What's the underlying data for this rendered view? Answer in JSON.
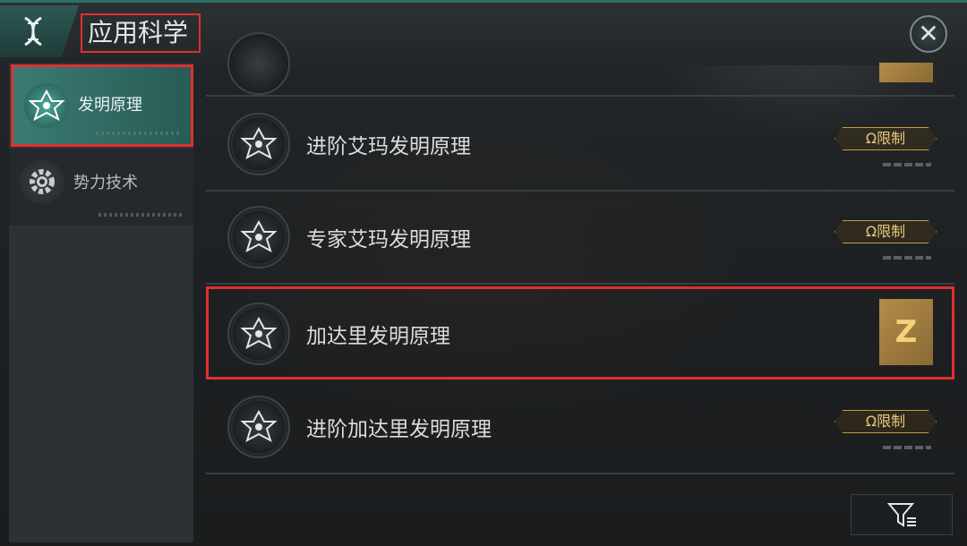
{
  "header": {
    "title": "应用科学",
    "logo_icon": "dna-icon",
    "close_icon": "close-icon",
    "close_symbol": "✕"
  },
  "sidebar": {
    "items": [
      {
        "label": "发明原理",
        "icon": "atom-star-icon",
        "active": true
      },
      {
        "label": "势力技术",
        "icon": "gear-icon",
        "active": false
      }
    ]
  },
  "list": {
    "rows": [
      {
        "name": "进阶艾玛发明原理",
        "badge": "Ω限制",
        "icon": "atom-star-icon"
      },
      {
        "name": "专家艾玛发明原理",
        "badge": "Ω限制",
        "icon": "atom-star-icon"
      },
      {
        "name": "加达里发明原理",
        "tile": "Z",
        "icon": "atom-star-icon"
      },
      {
        "name": "进阶加达里发明原理",
        "badge": "Ω限制",
        "icon": "atom-star-icon"
      }
    ]
  },
  "filter": {
    "icon": "filter-icon"
  },
  "colors": {
    "accent": "#2f6d66",
    "highlight_border": "#e0302f",
    "gold": "#c69a3e"
  }
}
